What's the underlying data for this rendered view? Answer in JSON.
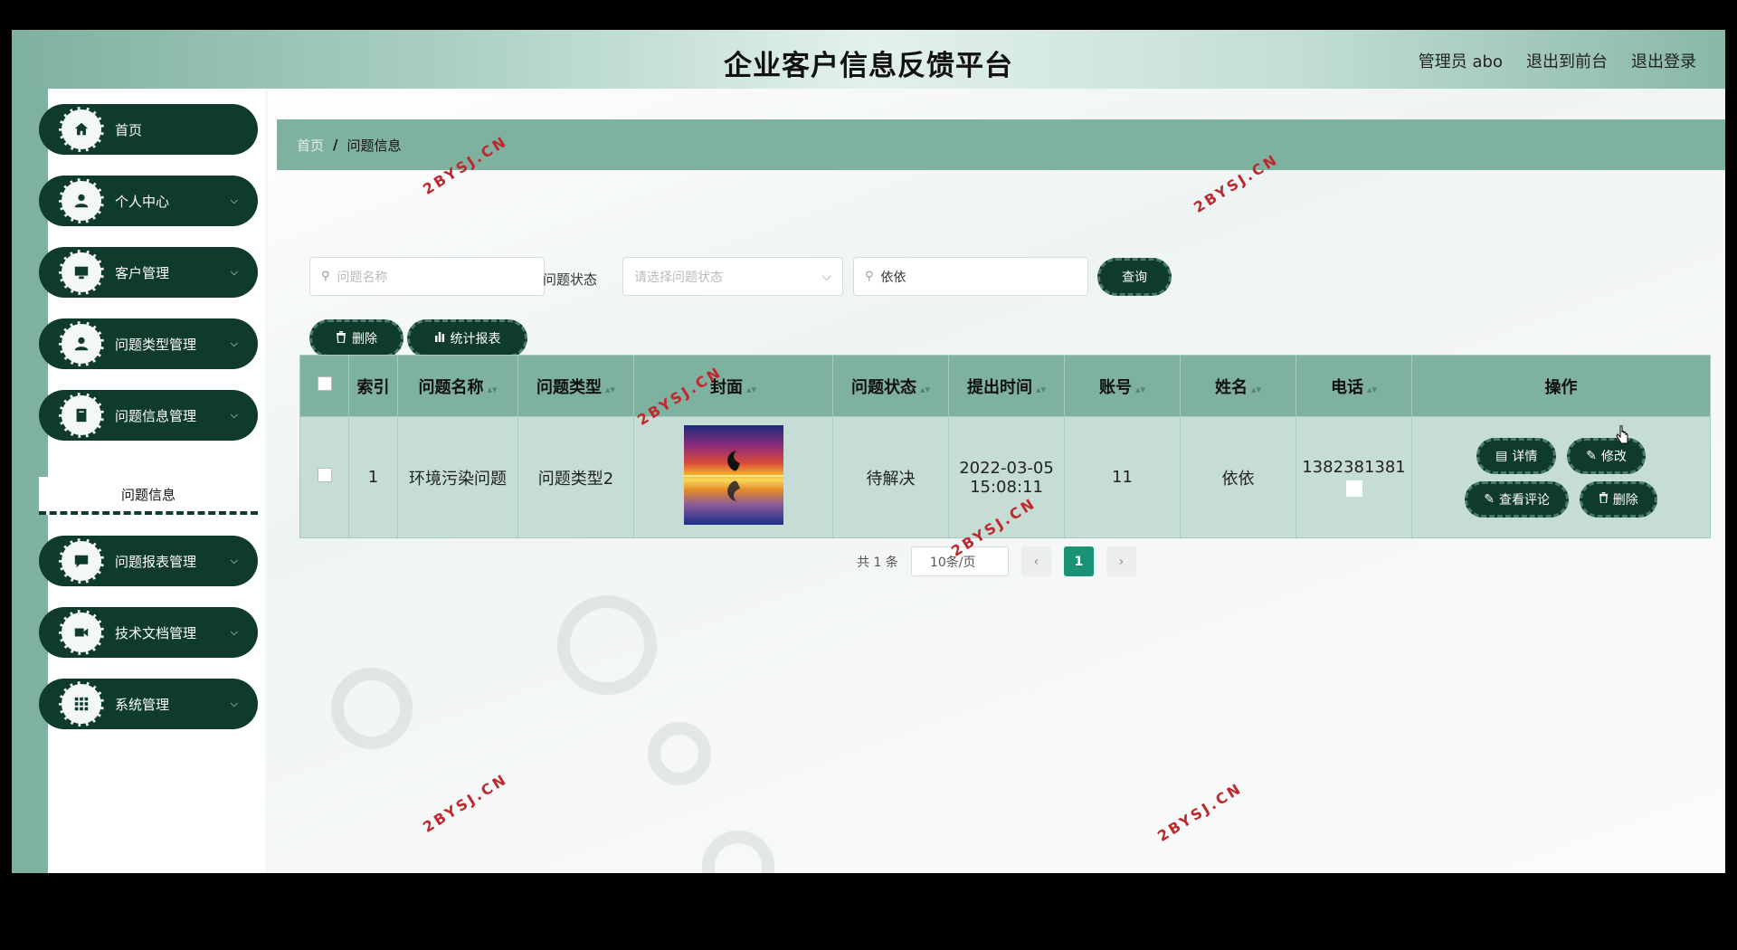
{
  "header": {
    "title": "企业客户信息反馈平台",
    "user": "管理员 abo",
    "to_front": "退出到前台",
    "logout": "退出登录"
  },
  "sidebar": {
    "items": [
      {
        "label": "首页",
        "icon": "home-icon"
      },
      {
        "label": "个人中心",
        "icon": "user-icon"
      },
      {
        "label": "客户管理",
        "icon": "monitor-icon"
      },
      {
        "label": "问题类型管理",
        "icon": "user-icon"
      },
      {
        "label": "问题信息管理",
        "icon": "document-icon"
      },
      {
        "label": "问题报表管理",
        "icon": "chat-icon"
      },
      {
        "label": "技术文档管理",
        "icon": "video-icon"
      },
      {
        "label": "系统管理",
        "icon": "grid-icon"
      }
    ],
    "sub_item": "问题信息"
  },
  "breadcrumb": {
    "home": "首页",
    "separator": "/",
    "current": "问题信息"
  },
  "search": {
    "name_placeholder": "问题名称",
    "status_label": "问题状态",
    "status_placeholder": "请选择问题状态",
    "name_filter_value": "依依",
    "query_button": "查询"
  },
  "toolbar": {
    "delete_button": "删除",
    "report_button": "统计报表"
  },
  "table": {
    "columns": [
      "索引",
      "问题名称",
      "问题类型",
      "封面",
      "问题状态",
      "提出时间",
      "账号",
      "姓名",
      "电话",
      "操作"
    ],
    "rows": [
      {
        "index": "1",
        "name": "环境污染问题",
        "type": "问题类型2",
        "status": "待解决",
        "date": "2022-03-05",
        "time": "15:08:11",
        "account": "11",
        "person": "依依",
        "phone": "1382381381"
      }
    ],
    "actions": {
      "detail": "详情",
      "edit": "修改",
      "comments": "查看评论",
      "delete": "删除"
    }
  },
  "pagination": {
    "total": "共 1 条",
    "page_size": "10条/页",
    "current_page": "1"
  },
  "watermark": "2BYSJ.CN",
  "colors": {
    "accent_dark": "#0e3b2e",
    "accent": "#7fb1a0",
    "page_active": "#1a9276"
  }
}
